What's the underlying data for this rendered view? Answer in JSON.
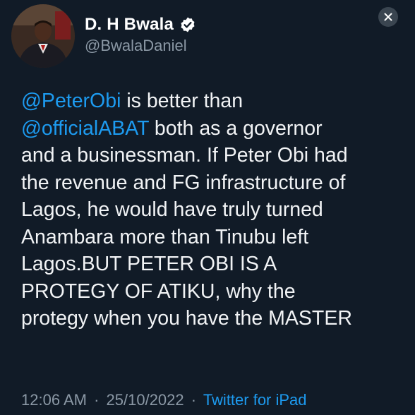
{
  "author": {
    "display_name": "D. H Bwala",
    "handle": "@BwalaDaniel",
    "verified": true
  },
  "tweet": {
    "lines": [
      [
        {
          "text": "@PeterObi",
          "mention": true
        },
        {
          "text": " is better than",
          "mention": false
        }
      ],
      [
        {
          "text": "@officialABAT",
          "mention": true
        },
        {
          "text": " both as a governor",
          "mention": false
        }
      ],
      [
        {
          "text": "and a businessman. If Peter Obi had",
          "mention": false
        }
      ],
      [
        {
          "text": "the revenue and FG infrastructure of",
          "mention": false
        }
      ],
      [
        {
          "text": "Lagos, he would have truly turned",
          "mention": false
        }
      ],
      [
        {
          "text": "Anambara more than Tinubu left",
          "mention": false
        }
      ],
      [
        {
          "text": "Lagos.BUT PETER OBI IS A",
          "mention": false
        }
      ],
      [
        {
          "text": "PROTEGY OF ATIKU, why the",
          "mention": false
        }
      ],
      [
        {
          "text": "protegy when you have the MASTER",
          "mention": false
        }
      ]
    ]
  },
  "meta": {
    "time": "12:06 AM",
    "separator": "·",
    "date": "25/10/2022",
    "source": "Twitter for iPad"
  },
  "icons": {
    "verified_badge": "verified-icon",
    "close": "close-icon"
  },
  "colors": {
    "background": "#111b27",
    "mention": "#1d9bf0",
    "secondary_text": "#8b98a5"
  }
}
